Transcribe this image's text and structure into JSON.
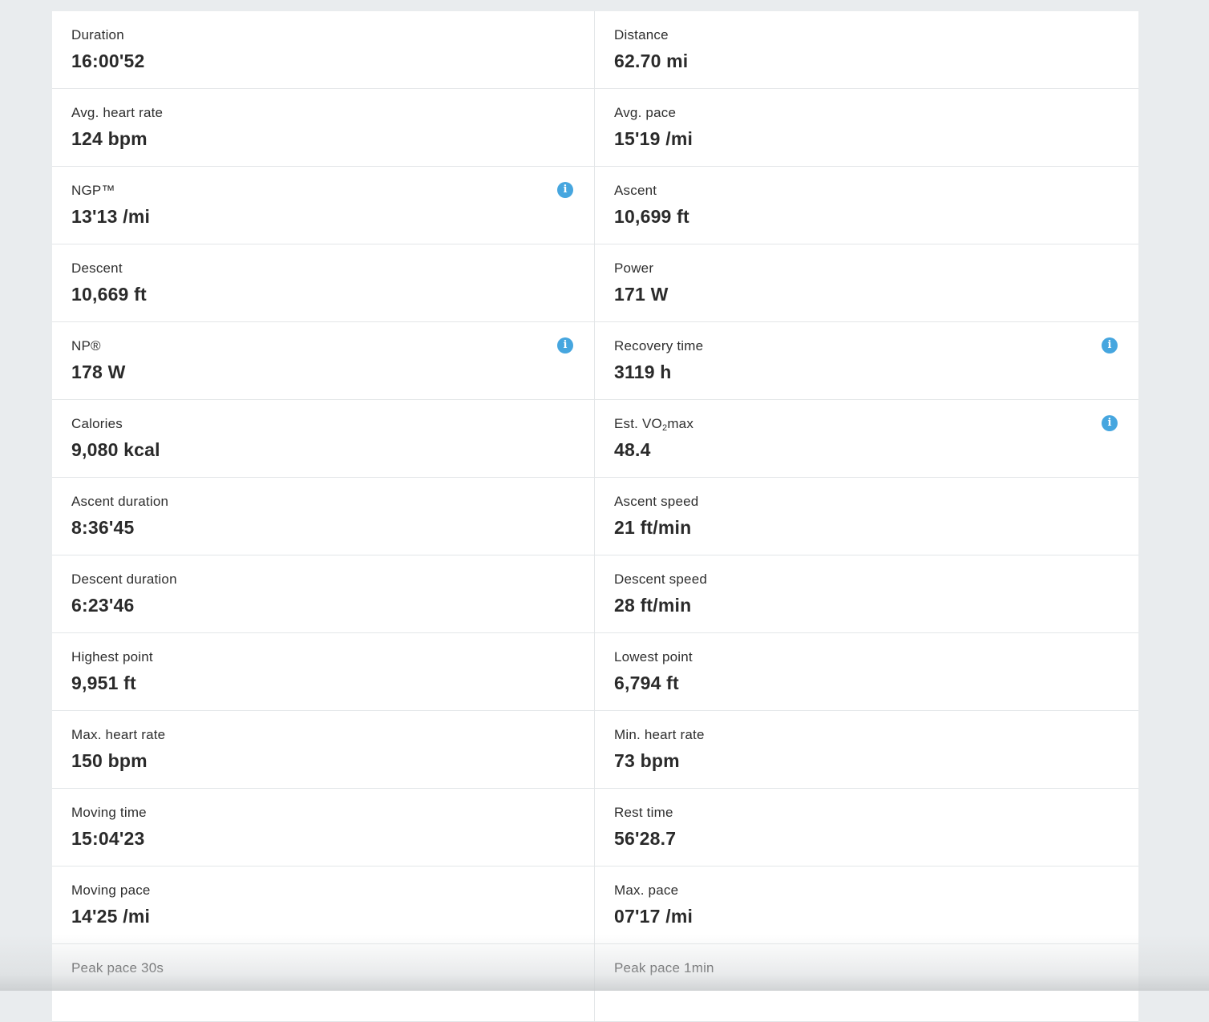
{
  "stats": [
    {
      "label": "Duration",
      "value": "16:00'52",
      "info": false
    },
    {
      "label": "Distance",
      "value": "62.70 mi",
      "info": false
    },
    {
      "label": "Avg. heart rate",
      "value": "124 bpm",
      "info": false
    },
    {
      "label": "Avg. pace",
      "value": "15'19 /mi",
      "info": false
    },
    {
      "label": "NGP™",
      "value": "13'13 /mi",
      "info": true
    },
    {
      "label": "Ascent",
      "value": "10,699 ft",
      "info": false
    },
    {
      "label": "Descent",
      "value": "10,669 ft",
      "info": false
    },
    {
      "label": "Power",
      "value": "171 W",
      "info": false
    },
    {
      "label": "NP®",
      "value": "178 W",
      "info": true
    },
    {
      "label": "Recovery time",
      "value": "3119 h",
      "info": true
    },
    {
      "label": "Calories",
      "value": "9,080 kcal",
      "info": false
    },
    {
      "label": "Est. VO",
      "label_sub": "2",
      "label_suffix": "max",
      "value": "48.4",
      "info": true
    },
    {
      "label": "Ascent duration",
      "value": "8:36'45",
      "info": false
    },
    {
      "label": "Ascent speed",
      "value": "21 ft/min",
      "info": false
    },
    {
      "label": "Descent duration",
      "value": "6:23'46",
      "info": false
    },
    {
      "label": "Descent speed",
      "value": "28 ft/min",
      "info": false
    },
    {
      "label": "Highest point",
      "value": "9,951 ft",
      "info": false
    },
    {
      "label": "Lowest point",
      "value": "6,794 ft",
      "info": false
    },
    {
      "label": "Max. heart rate",
      "value": "150 bpm",
      "info": false
    },
    {
      "label": "Min. heart rate",
      "value": "73 bpm",
      "info": false
    },
    {
      "label": "Moving time",
      "value": "15:04'23",
      "info": false
    },
    {
      "label": "Rest time",
      "value": "56'28.7",
      "info": false
    },
    {
      "label": "Moving pace",
      "value": "14'25 /mi",
      "info": false
    },
    {
      "label": "Max. pace",
      "value": "07'17 /mi",
      "info": false
    },
    {
      "label": "Peak pace 30s",
      "value": "",
      "info": false
    },
    {
      "label": "Peak pace 1min",
      "value": "",
      "info": false
    }
  ],
  "icons": {
    "info": "info-icon",
    "info_glyph": "i"
  },
  "colors": {
    "info_icon": "#46a6df",
    "background": "#e9ecee",
    "panel": "#ffffff"
  }
}
